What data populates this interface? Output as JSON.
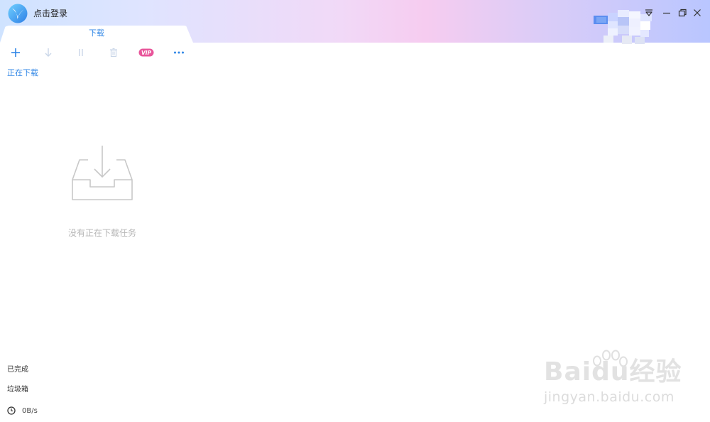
{
  "titlebar": {
    "login_label": "点击登录"
  },
  "tabs": [
    {
      "label": "下载",
      "active": true
    }
  ],
  "toolbar": {
    "add": "add-icon",
    "download": "download-icon",
    "pause": "pause-icon",
    "delete": "trash-icon",
    "vip_label": "VIP",
    "more": "more-icon"
  },
  "sections": {
    "downloading_label": "正在下载"
  },
  "empty_state": {
    "message": "没有正在下载任务"
  },
  "bottom_nav": {
    "completed_label": "已完成",
    "trash_label": "垃圾箱"
  },
  "status": {
    "speed": "0B/s"
  },
  "watermark": {
    "brand": "Baidu经验",
    "url": "jingyan.baidu.com"
  },
  "colors": {
    "accent": "#2f86e6",
    "vip": "#e8559a",
    "empty_text": "#b5b5b5",
    "icon_disabled": "#c9d6e8"
  }
}
